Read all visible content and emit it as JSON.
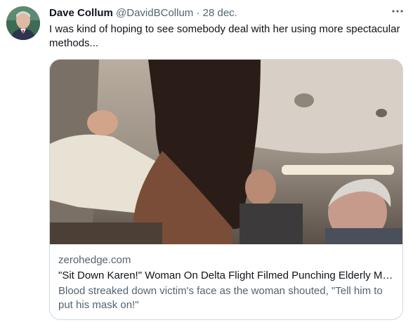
{
  "tweet": {
    "author_name": "Dave Collum",
    "author_handle": "@DavidBCollum",
    "separator": "·",
    "date": "28 dec.",
    "text": "I was kind of hoping to see somebody deal with her using more spectacular methods...",
    "more_icon": "more-horizontal-icon"
  },
  "card": {
    "domain": "zerohedge.com",
    "title": "\"Sit Down Karen!\" Woman On Delta Flight Filmed Punching Elderly Man...",
    "description": "Blood streaked down victim's face as the woman shouted, \"Tell him to put his mask on!\""
  },
  "colors": {
    "text_primary": "#0f1419",
    "text_secondary": "#536471",
    "border": "#cfd9de"
  }
}
